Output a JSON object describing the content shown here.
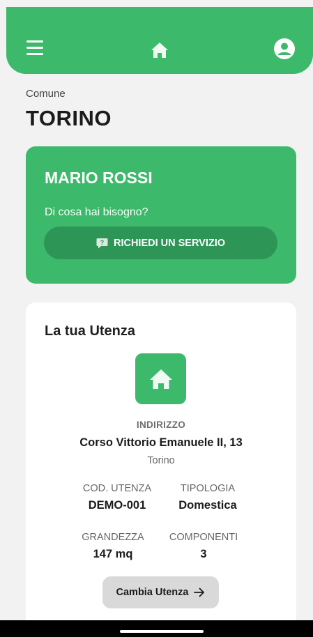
{
  "header": {
    "menu_icon": "hamburger-icon",
    "home_icon": "home-icon",
    "profile_icon": "user-avatar-icon",
    "color": "#3cb96a"
  },
  "location": {
    "label": "Comune",
    "city": "TORINO"
  },
  "user_card": {
    "name": "MARIO ROSSI",
    "prompt": "Di cosa hai bisogno?",
    "service_button": "RICHIEDI UN SERVIZIO",
    "service_icon": "chat-question-icon"
  },
  "utenza": {
    "title": "La tua Utenza",
    "icon": "home-icon",
    "address_label": "INDIRIZZO",
    "address": "Corso Vittorio Emanuele II, 13",
    "city": "Torino",
    "fields": {
      "code_label": "COD. UTENZA",
      "code_value": "DEMO-001",
      "type_label": "TIPOLOGIA",
      "type_value": "Domestica",
      "size_label": "GRANDEZZA",
      "size_value": "147 mq",
      "members_label": "COMPONENTI",
      "members_value": "3"
    },
    "change_button": "Cambia Utenza"
  },
  "colors": {
    "accent": "#3cb96a",
    "accent_dark": "#2d9656",
    "background": "#f2f2f2"
  }
}
